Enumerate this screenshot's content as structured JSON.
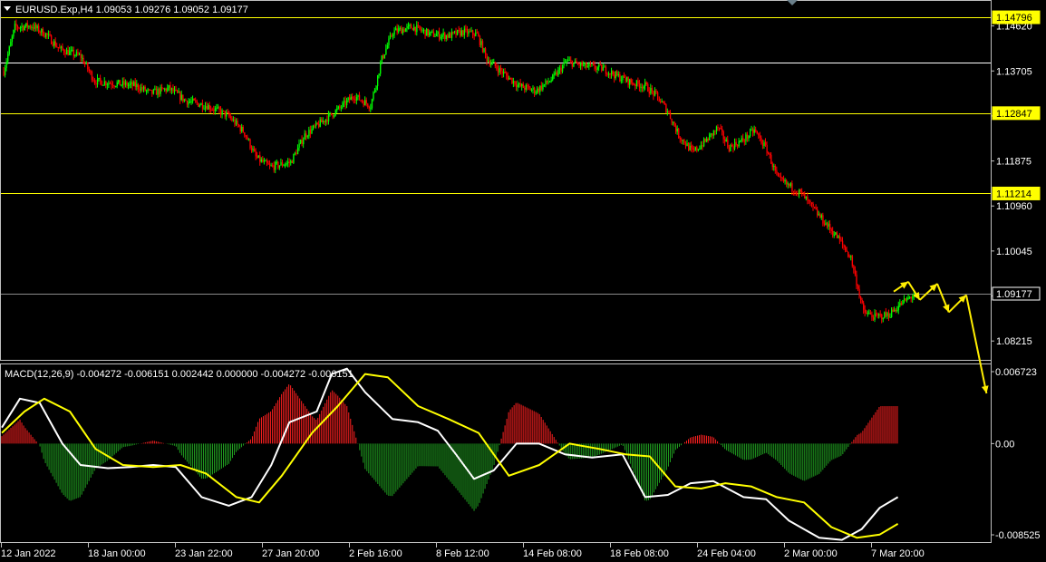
{
  "window": {
    "symbol_info": "EURUSD.Exp,H4  1.09053 1.09276 1.09052 1.09177",
    "macd_info": "MACD(12,26,9) -0.004272 -0.006151 0.002442 0.000000 -0.004272 -0.006151"
  },
  "colors": {
    "background": "#000000",
    "bull": "#00ff00",
    "bear": "#ff0000",
    "support_resistance": "#ffff00",
    "macd_main": "#ffffff",
    "macd_signal": "#ffff00",
    "hist_pos": "#ff2020",
    "hist_neg": "#20a020",
    "forecast_arrow": "#ffee00"
  },
  "chart_data": {
    "type": "candlestick",
    "price_axis": {
      "ticks": [
        "1.14620",
        "1.13705",
        "1.12790",
        "1.11875",
        "1.10960",
        "1.10045",
        "1.09130",
        "1.08215"
      ],
      "range": [
        1.0785,
        1.15
      ]
    },
    "levels": [
      {
        "price": 1.14796,
        "label": "1.14796",
        "color": "#ffff00",
        "show_label": true
      },
      {
        "price": 1.1388,
        "label": "",
        "color": "#ffffff",
        "show_label": false
      },
      {
        "price": 1.12847,
        "label": "1.12847",
        "color": "#ffff00",
        "show_label": true
      },
      {
        "price": 1.11214,
        "label": "1.11214",
        "color": "#ffff00",
        "show_label": true
      }
    ],
    "current_price": {
      "price": 1.09177,
      "label": "1.09177"
    },
    "macd_axis": {
      "ticks": [
        "0.006723",
        "0.00",
        "-0.008525"
      ],
      "range": [
        -0.0092,
        0.0074
      ]
    },
    "time_axis": {
      "labels": [
        "12 Jan 2022",
        "18 Jan 00:00",
        "23 Jan 22:00",
        "27 Jan 20:00",
        "2 Feb 16:00",
        "8 Feb 12:00",
        "14 Feb 08:00",
        "18 Feb 08:00",
        "24 Feb 04:00",
        "2 Mar 00:00",
        "7 Mar 20:00"
      ]
    },
    "price_path": [
      [
        0,
        1.137
      ],
      [
        8,
        1.146
      ],
      [
        20,
        1.1462
      ],
      [
        30,
        1.1445
      ],
      [
        40,
        1.1415
      ],
      [
        55,
        1.14
      ],
      [
        65,
        1.135
      ],
      [
        80,
        1.1345
      ],
      [
        95,
        1.134
      ],
      [
        105,
        1.1325
      ],
      [
        118,
        1.1335
      ],
      [
        130,
        1.131
      ],
      [
        145,
        1.13
      ],
      [
        160,
        1.128
      ],
      [
        172,
        1.1245
      ],
      [
        180,
        1.1195
      ],
      [
        190,
        1.1175
      ],
      [
        205,
        1.1185
      ],
      [
        215,
        1.124
      ],
      [
        225,
        1.1262
      ],
      [
        240,
        1.1295
      ],
      [
        250,
        1.132
      ],
      [
        262,
        1.13
      ],
      [
        270,
        1.1395
      ],
      [
        278,
        1.145
      ],
      [
        292,
        1.146
      ],
      [
        305,
        1.1445
      ],
      [
        318,
        1.1442
      ],
      [
        328,
        1.145
      ],
      [
        338,
        1.1445
      ],
      [
        345,
        1.1395
      ],
      [
        355,
        1.137
      ],
      [
        368,
        1.134
      ],
      [
        380,
        1.133
      ],
      [
        392,
        1.1355
      ],
      [
        402,
        1.139
      ],
      [
        415,
        1.138
      ],
      [
        428,
        1.1375
      ],
      [
        438,
        1.136
      ],
      [
        450,
        1.1345
      ],
      [
        458,
        1.134
      ],
      [
        466,
        1.132
      ],
      [
        474,
        1.129
      ],
      [
        482,
        1.124
      ],
      [
        492,
        1.1205
      ],
      [
        502,
        1.123
      ],
      [
        510,
        1.1255
      ],
      [
        518,
        1.1215
      ],
      [
        528,
        1.123
      ],
      [
        536,
        1.125
      ],
      [
        545,
        1.121
      ],
      [
        553,
        1.115
      ],
      [
        562,
        1.1135
      ],
      [
        570,
        1.112
      ],
      [
        578,
        1.109
      ],
      [
        587,
        1.106
      ],
      [
        596,
        1.103
      ],
      [
        605,
        1.099
      ],
      [
        614,
        1.088
      ],
      [
        622,
        1.087
      ],
      [
        632,
        1.0875
      ],
      [
        642,
        1.09
      ],
      [
        650,
        1.0915
      ]
    ],
    "macd_main_path": [
      [
        0,
        0.0015
      ],
      [
        12,
        0.0042
      ],
      [
        25,
        0.0038
      ],
      [
        40,
        0.0
      ],
      [
        52,
        -0.002
      ],
      [
        70,
        -0.0023
      ],
      [
        85,
        -0.0022
      ],
      [
        100,
        -0.002
      ],
      [
        115,
        -0.0022
      ],
      [
        132,
        -0.005
      ],
      [
        150,
        -0.0058
      ],
      [
        165,
        -0.005
      ],
      [
        178,
        -0.002
      ],
      [
        190,
        0.002
      ],
      [
        208,
        0.003
      ],
      [
        218,
        0.0065
      ],
      [
        228,
        0.007
      ],
      [
        240,
        0.0048
      ],
      [
        258,
        0.0023
      ],
      [
        275,
        0.002
      ],
      [
        288,
        0.0012
      ],
      [
        300,
        -0.001
      ],
      [
        312,
        -0.0033
      ],
      [
        325,
        -0.0025
      ],
      [
        340,
        0.0
      ],
      [
        355,
        0.0
      ],
      [
        372,
        -0.001
      ],
      [
        390,
        -0.0013
      ],
      [
        410,
        -0.001
      ],
      [
        425,
        -0.005
      ],
      [
        440,
        -0.0048
      ],
      [
        455,
        -0.0037
      ],
      [
        470,
        -0.0035
      ],
      [
        490,
        -0.005
      ],
      [
        505,
        -0.0052
      ],
      [
        520,
        -0.0072
      ],
      [
        540,
        -0.0088
      ],
      [
        555,
        -0.009
      ],
      [
        568,
        -0.008
      ],
      [
        580,
        -0.006
      ],
      [
        592,
        -0.005
      ]
    ],
    "macd_signal_path": [
      [
        0,
        0.001
      ],
      [
        15,
        0.003
      ],
      [
        28,
        0.0042
      ],
      [
        45,
        0.003
      ],
      [
        62,
        -0.0005
      ],
      [
        80,
        -0.002
      ],
      [
        100,
        -0.0022
      ],
      [
        118,
        -0.002
      ],
      [
        135,
        -0.0028
      ],
      [
        155,
        -0.005
      ],
      [
        170,
        -0.0055
      ],
      [
        185,
        -0.003
      ],
      [
        205,
        0.001
      ],
      [
        222,
        0.0035
      ],
      [
        240,
        0.0065
      ],
      [
        255,
        0.0062
      ],
      [
        275,
        0.0035
      ],
      [
        295,
        0.0023
      ],
      [
        315,
        0.001
      ],
      [
        335,
        -0.003
      ],
      [
        355,
        -0.002
      ],
      [
        375,
        0.0
      ],
      [
        395,
        -0.0005
      ],
      [
        412,
        -0.001
      ],
      [
        428,
        -0.0012
      ],
      [
        445,
        -0.004
      ],
      [
        462,
        -0.0042
      ],
      [
        478,
        -0.0037
      ],
      [
        495,
        -0.004
      ],
      [
        512,
        -0.005
      ],
      [
        530,
        -0.0055
      ],
      [
        548,
        -0.0078
      ],
      [
        565,
        -0.0088
      ],
      [
        580,
        -0.0085
      ],
      [
        592,
        -0.0075
      ]
    ],
    "forecast_arrow_path": [
      [
        0,
        1.0922
      ],
      [
        10,
        1.0942
      ],
      [
        18,
        1.0905
      ],
      [
        30,
        1.0938
      ],
      [
        38,
        1.088
      ],
      [
        50,
        1.0915
      ],
      [
        64,
        1.0815
      ]
    ]
  }
}
